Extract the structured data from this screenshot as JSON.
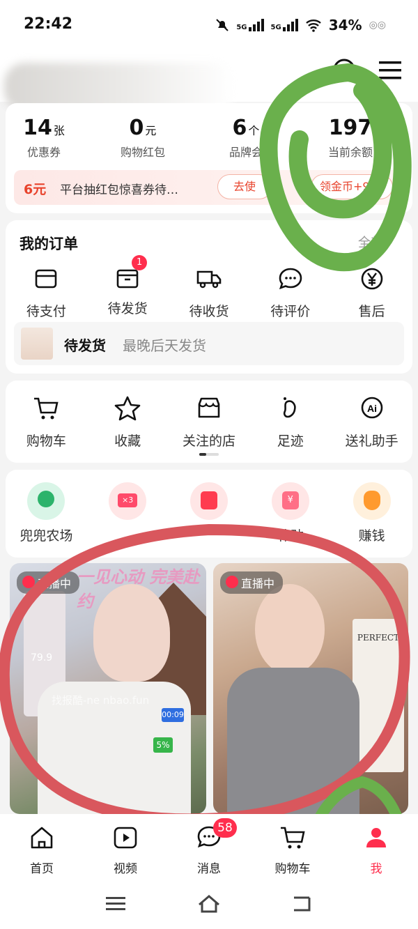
{
  "status_bar": {
    "time": "22:42",
    "net1": "5G",
    "net2": "5G",
    "battery": "34%"
  },
  "assets": [
    {
      "value": "14",
      "unit": "张",
      "label": "优惠券"
    },
    {
      "value": "0",
      "unit": "元",
      "label": "购物红包"
    },
    {
      "value": "6",
      "unit": "个",
      "label": "品牌会"
    },
    {
      "value": "197",
      "unit": "",
      "label": "当前余额"
    }
  ],
  "promo": {
    "amount": "6元",
    "text": "平台抽红包惊喜券待…",
    "use_label": "去使",
    "coins_label": "领金币+944"
  },
  "orders": {
    "title": "我的订单",
    "all_label": "全部",
    "items": [
      {
        "label": "待支付",
        "icon": "wallet-icon"
      },
      {
        "label": "待发货",
        "icon": "box-icon",
        "badge": "1"
      },
      {
        "label": "待收货",
        "icon": "truck-icon"
      },
      {
        "label": "待评价",
        "icon": "comment-icon"
      },
      {
        "label": "售后",
        "icon": "refund-icon"
      }
    ],
    "shipment": {
      "status": "待发货",
      "note": "最晚后天发货"
    }
  },
  "tools": [
    {
      "label": "购物车",
      "icon": "cart-icon"
    },
    {
      "label": "收藏",
      "icon": "star-icon"
    },
    {
      "label": "关注的店",
      "icon": "store-icon"
    },
    {
      "label": "足迹",
      "icon": "footprint-icon"
    },
    {
      "label": "送礼助手",
      "icon": "ai-icon"
    }
  ],
  "services": [
    {
      "label": "兜兜农场",
      "icon": "farm-icon"
    },
    {
      "label": "",
      "icon": "coupon-x3-icon"
    },
    {
      "label": "",
      "icon": "redpacket-icon"
    },
    {
      "label": "补贴",
      "icon": "subsidy-icon"
    },
    {
      "label": "赚钱",
      "icon": "moneybag-icon"
    }
  ],
  "live_tiles": [
    {
      "badge": "直播中",
      "overlay": "一见心动 完美赴约",
      "price": "79.9",
      "timer": "00:09",
      "discount": "5%",
      "watermark": "找报酷-ne      nbao.fun"
    },
    {
      "badge": "直播中",
      "overlay": "PERFECT"
    }
  ],
  "tabbar": [
    {
      "label": "首页",
      "icon": "home-icon"
    },
    {
      "label": "视频",
      "icon": "video-icon"
    },
    {
      "label": "消息",
      "icon": "message-icon",
      "badge": "58"
    },
    {
      "label": "购物车",
      "icon": "cart-icon"
    },
    {
      "label": "我",
      "icon": "profile-icon",
      "active": true
    }
  ],
  "colors": {
    "accent": "#ff2e4d",
    "promo_red": "#e8432c",
    "highlight_green": "#6ab04c",
    "highlight_red": "#d9575d"
  }
}
